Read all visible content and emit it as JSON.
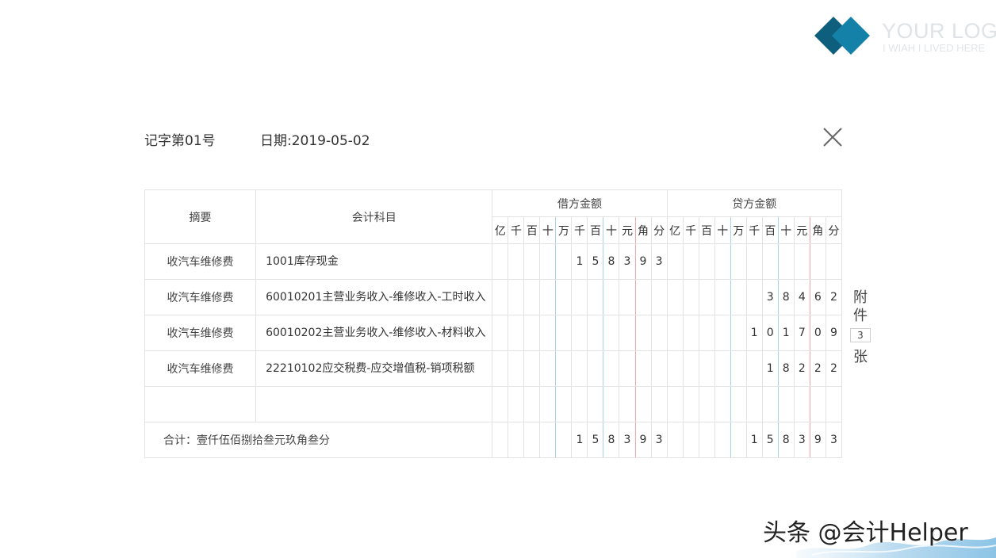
{
  "logo": {
    "title": "YOUR LOGO",
    "subtitle": "I WIAH I LIVED HERE",
    "colors": {
      "dark": "#0e5f7e",
      "light": "#1482a8"
    }
  },
  "header": {
    "voucher_no": "记字第01号",
    "date": "日期:2019-05-02",
    "close_icon": "close-icon"
  },
  "table": {
    "col_summary": "摘要",
    "col_account": "会计科目",
    "debit_label": "借方金额",
    "credit_label": "贷方金额",
    "digit_units": [
      "亿",
      "千",
      "百",
      "十",
      "万",
      "千",
      "百",
      "十",
      "元",
      "角",
      "分"
    ],
    "rows": [
      {
        "summary": "收汽车维修费",
        "account": "1001库存现金",
        "debit": [
          "",
          "",
          "",
          "",
          "",
          "1",
          "5",
          "8",
          "3",
          "9",
          "3"
        ],
        "credit": [
          "",
          "",
          "",
          "",
          "",
          "",
          "",
          "",
          "",
          "",
          ""
        ]
      },
      {
        "summary": "收汽车维修费",
        "account": "60010201主营业务收入-维修收入-工时收入",
        "debit": [
          "",
          "",
          "",
          "",
          "",
          "",
          "",
          "",
          "",
          "",
          ""
        ],
        "credit": [
          "",
          "",
          "",
          "",
          "",
          "",
          "3",
          "8",
          "4",
          "6",
          "2"
        ]
      },
      {
        "summary": "收汽车维修费",
        "account": "60010202主营业务收入-维修收入-材料收入",
        "debit": [
          "",
          "",
          "",
          "",
          "",
          "",
          "",
          "",
          "",
          "",
          ""
        ],
        "credit": [
          "",
          "",
          "",
          "",
          "",
          "1",
          "0",
          "1",
          "7",
          "0",
          "9"
        ]
      },
      {
        "summary": "收汽车维修费",
        "account": "22210102应交税费-应交增值税-销项税额",
        "debit": [
          "",
          "",
          "",
          "",
          "",
          "",
          "",
          "",
          "",
          "",
          ""
        ],
        "credit": [
          "",
          "",
          "",
          "",
          "",
          "",
          "1",
          "8",
          "2",
          "2",
          "2"
        ]
      },
      {
        "summary": "",
        "account": "",
        "debit": [
          "",
          "",
          "",
          "",
          "",
          "",
          "",
          "",
          "",
          "",
          ""
        ],
        "credit": [
          "",
          "",
          "",
          "",
          "",
          "",
          "",
          "",
          "",
          "",
          ""
        ]
      }
    ],
    "total": {
      "label": "合计：壹仟伍佰捌拾叁元玖角叁分",
      "debit": [
        "",
        "",
        "",
        "",
        "",
        "1",
        "5",
        "8",
        "3",
        "9",
        "3"
      ],
      "credit": [
        "",
        "",
        "",
        "",
        "",
        "1",
        "5",
        "8",
        "3",
        "9",
        "3"
      ]
    }
  },
  "attachments": {
    "char1": "附",
    "char2": "件",
    "count": "3",
    "unit": "张"
  },
  "watermark": "头条 @会计Helper"
}
